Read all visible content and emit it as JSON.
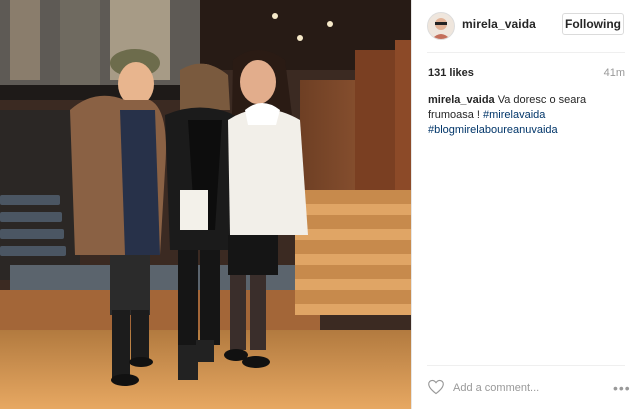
{
  "post": {
    "username": "mirela_vaida",
    "follow_label": "Following",
    "likes": "131 likes",
    "time": "41m",
    "caption_user": "mirela_vaida",
    "caption_text": " Va doresc o seara frumoasa ! ",
    "hashtags": [
      "#mirelavaida",
      "#blogmirelaboureanuvaida"
    ]
  },
  "comment": {
    "placeholder": "Add a comment...",
    "more": "•••"
  },
  "icons": {
    "heart": "heart-icon",
    "more": "more-options-icon",
    "avatar": "avatar"
  },
  "colors": {
    "text": "#262626",
    "hashtag": "#003569",
    "muted": "#999999",
    "border": "#dbdbdb"
  }
}
